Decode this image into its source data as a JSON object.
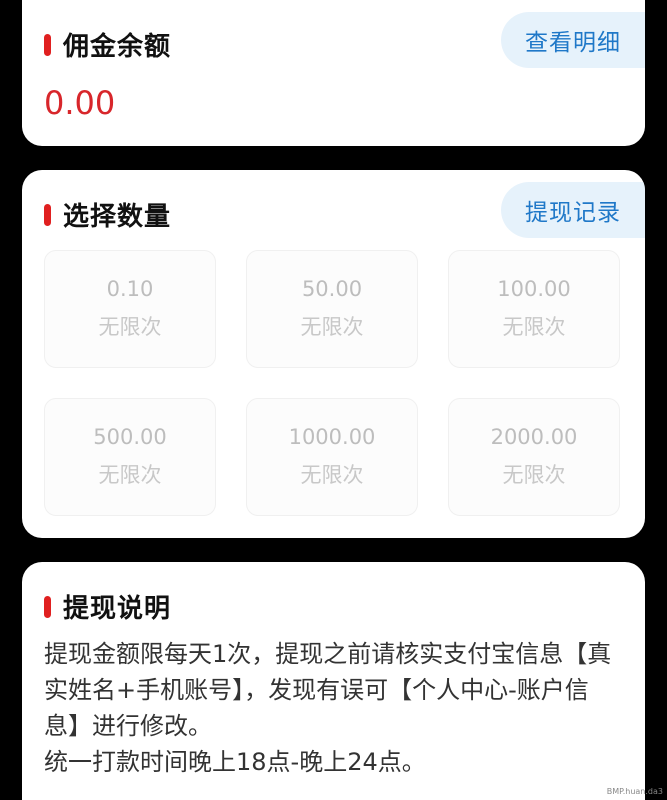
{
  "balance": {
    "title": "佣金余额",
    "details_button": "查看明细",
    "amount": "0.00"
  },
  "select": {
    "title": "选择数量",
    "records_button": "提现记录",
    "options": [
      {
        "amount": "0.10",
        "limit": "无限次"
      },
      {
        "amount": "50.00",
        "limit": "无限次"
      },
      {
        "amount": "100.00",
        "limit": "无限次"
      },
      {
        "amount": "500.00",
        "limit": "无限次"
      },
      {
        "amount": "1000.00",
        "limit": "无限次"
      },
      {
        "amount": "2000.00",
        "limit": "无限次"
      }
    ]
  },
  "notes": {
    "title": "提现说明",
    "lines": [
      "提现金额限每天1次，提现之前请核实支付宝信息【真实姓名+手机账号】，发现有误可【个人中心-账户信息】进行修改。",
      "统一打款时间晚上18点-晚上24点。"
    ]
  },
  "watermark": "BMP.huan.da3"
}
